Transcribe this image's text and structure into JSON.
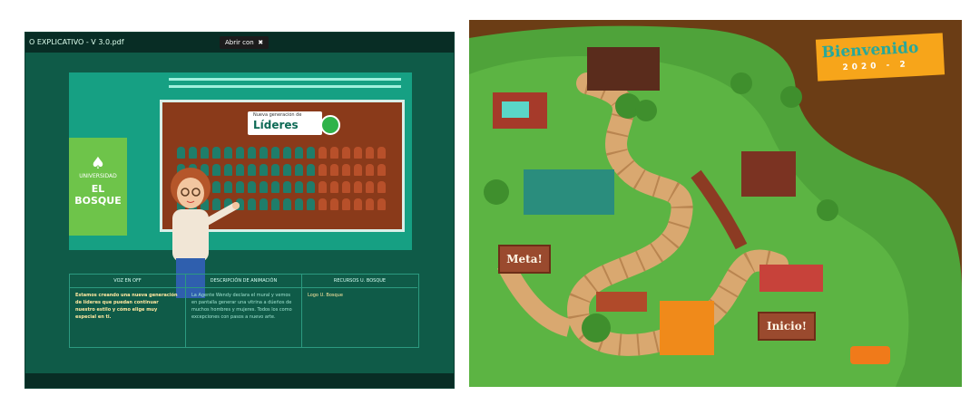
{
  "pdf_viewer": {
    "filename": "O EXPLICATIVO - V 3.0.pdf",
    "open_with_label": "Abrir con",
    "open_with_icon": "close-icon"
  },
  "slide": {
    "logo_line1": "UNIVERSIDAD",
    "logo_line2": "EL BOSQUE",
    "banner_small": "Nueva generación de",
    "banner_title": "Líderes"
  },
  "info_table": {
    "columns": [
      {
        "header": "VOZ EN OFF",
        "body": "Estamos creando una nueva generación de líderes que puedan continuar nuestro estilo y cómo elige muy especial en ti."
      },
      {
        "header": "DESCRIPCIÓN DE ANIMACIÓN",
        "body": "La Agente Wendy declara el mural y vemos en pantalla generar una vitrina a dúeños de muchos hombres y mujeres. Todos los como excepciones con pasos a nuevo arte."
      },
      {
        "header": "RECURSOS U. BOSQUE",
        "body": "Logo U. Bosque"
      }
    ]
  },
  "game_board": {
    "welcome_title": "Bienvenido",
    "welcome_year": "2020 - 2",
    "meta_label": "Meta!",
    "inicio_label": "Inicio!"
  },
  "colors": {
    "viewer_bg": "#0f5b48",
    "slide_accent": "#16a083",
    "board_grass": "#4fa33a",
    "path": "#d9a870",
    "banner": "#f7a51a"
  }
}
